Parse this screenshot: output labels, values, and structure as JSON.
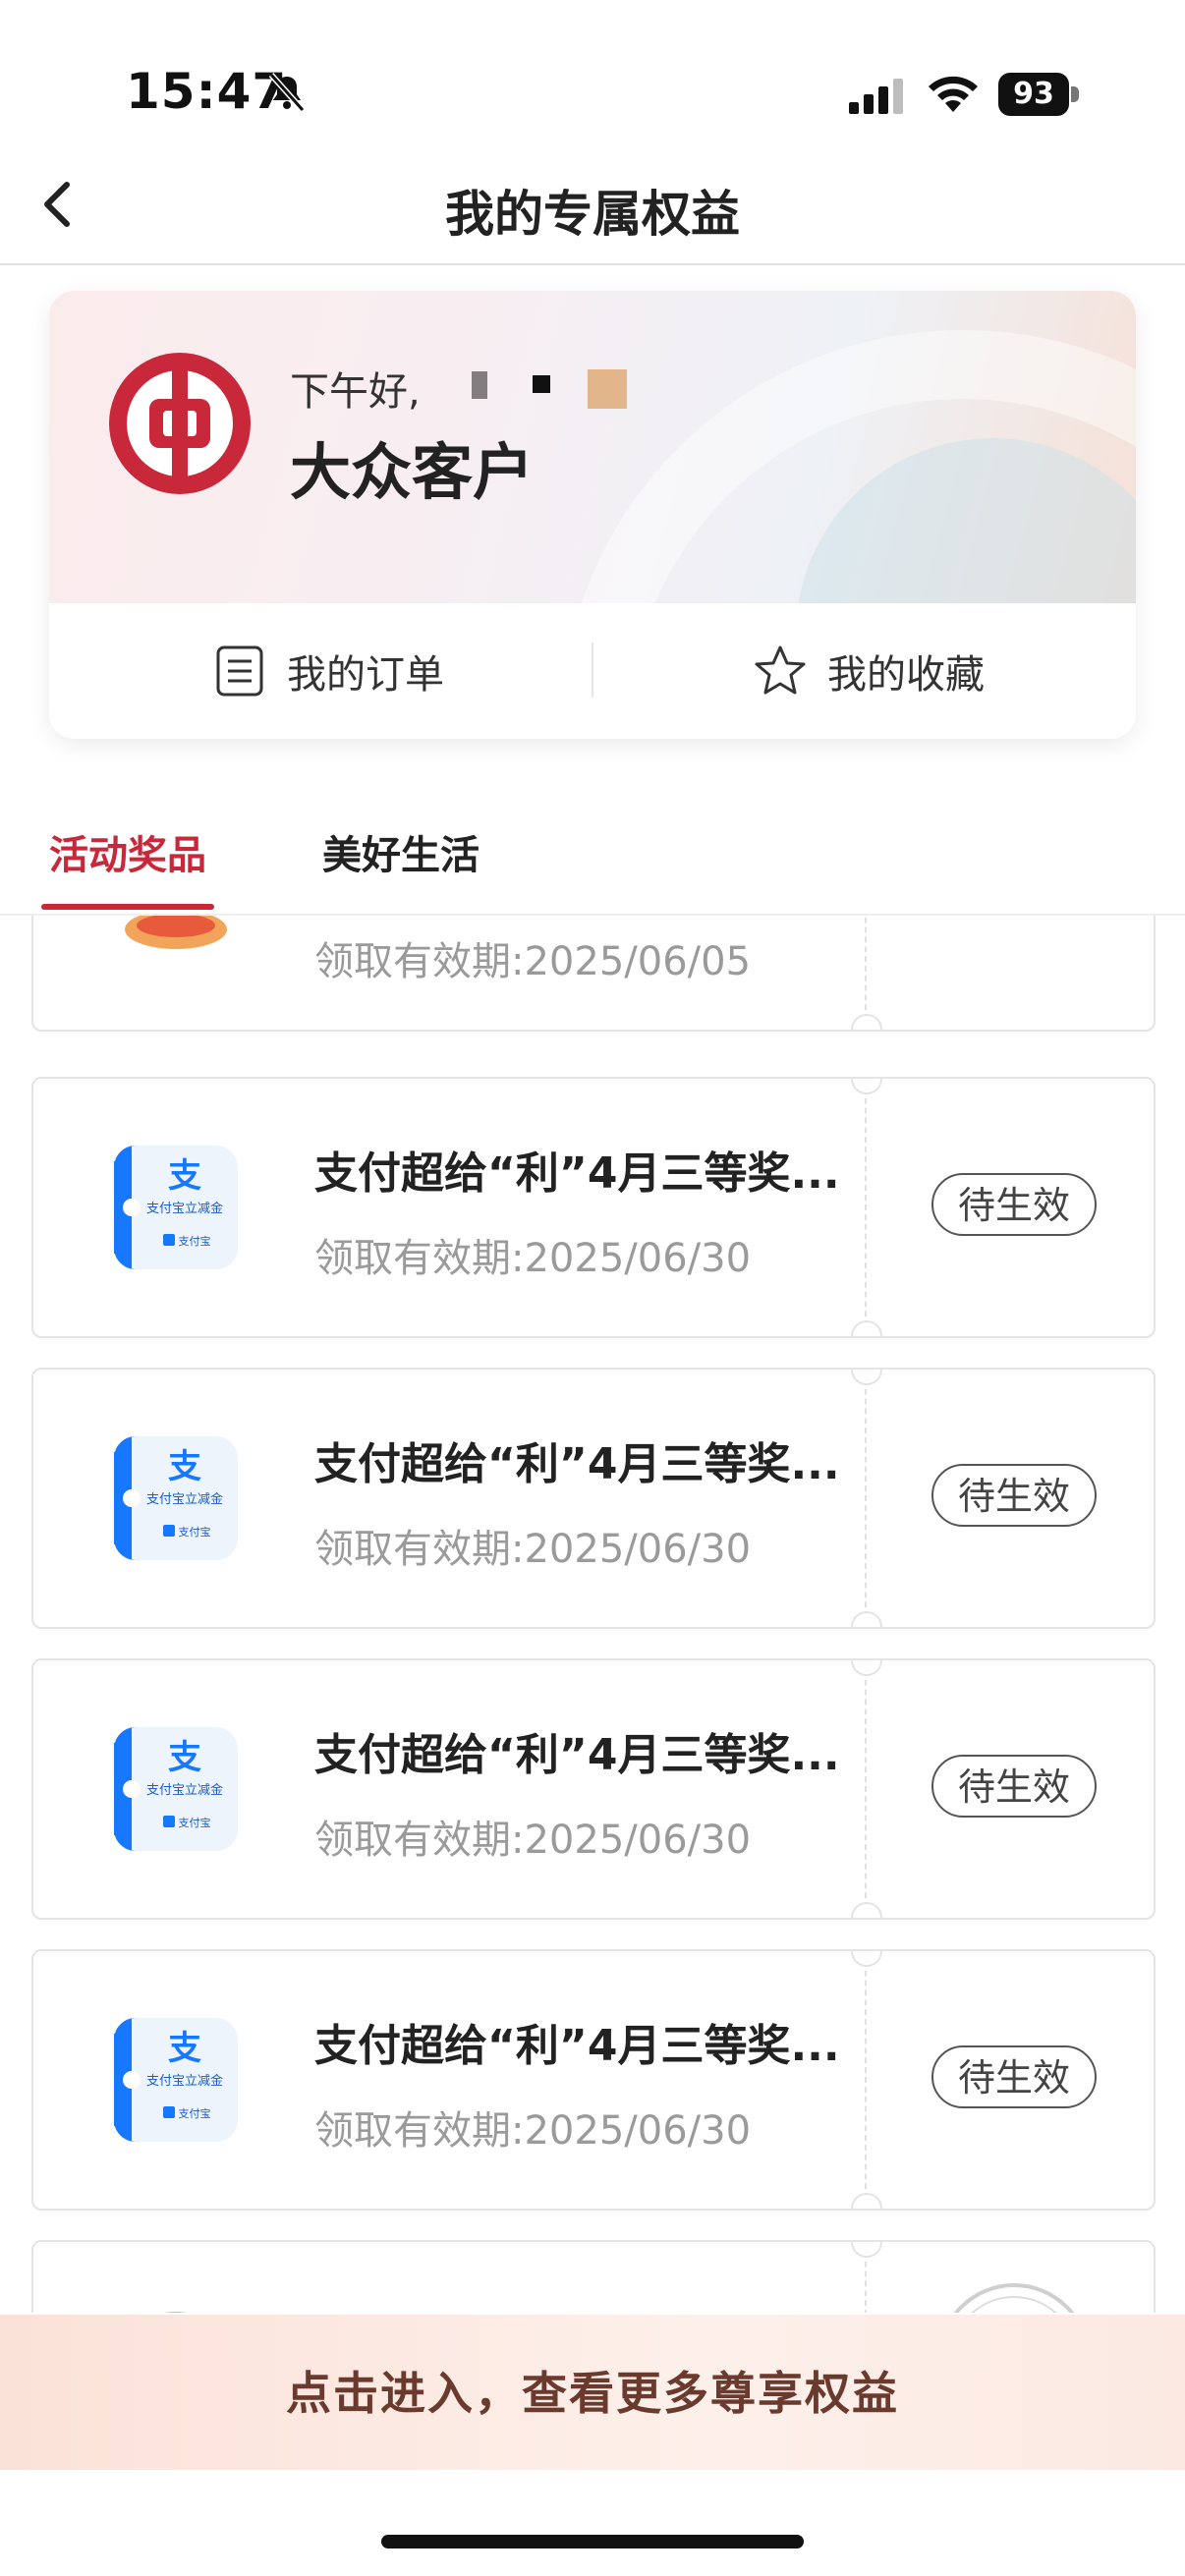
{
  "status_bar": {
    "time": "15:47",
    "battery": "93"
  },
  "nav": {
    "title": "我的专属权益"
  },
  "profile": {
    "greeting": "下午好,",
    "member_level": "大众客户",
    "quick_links": [
      {
        "label": "我的订单",
        "icon": "order-list-icon"
      },
      {
        "label": "我的收藏",
        "icon": "star-icon"
      }
    ]
  },
  "tabs": [
    {
      "label": "活动奖品",
      "active": true
    },
    {
      "label": "美好生活",
      "active": false
    }
  ],
  "tickets": [
    {
      "name": "",
      "validity": "领取有效期:2025/06/05",
      "status": ""
    },
    {
      "name": "支付超给“利”4月三等奖...",
      "validity": "领取有效期:2025/06/30",
      "status": "待生效"
    },
    {
      "name": "支付超给“利”4月三等奖...",
      "validity": "领取有效期:2025/06/30",
      "status": "待生效"
    },
    {
      "name": "支付超给“利”4月三等奖...",
      "validity": "领取有效期:2025/06/30",
      "status": "待生效"
    },
    {
      "name": "支付超给“利”4月三等奖...",
      "validity": "领取有效期:2025/06/30",
      "status": "待生效"
    }
  ],
  "coupon_thumb": {
    "title": "支",
    "subtitle": "支付宝立减金",
    "brand": "支付宝"
  },
  "cta": {
    "label": "点击进入，查看更多尊享权益"
  },
  "colors": {
    "accent": "#c8283a",
    "alipay_blue": "#1677ff"
  }
}
